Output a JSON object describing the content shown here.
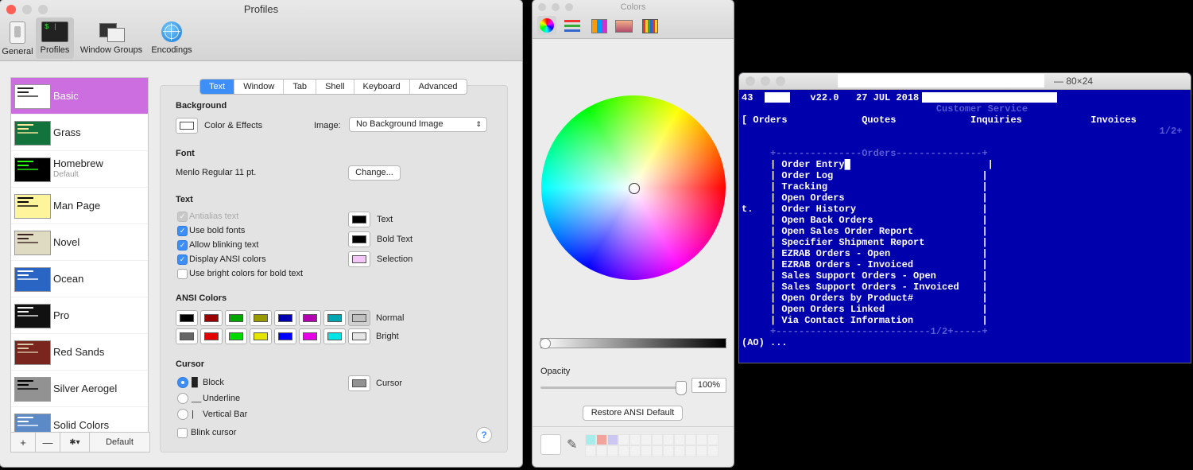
{
  "prefs": {
    "title": "Profiles",
    "toolbar": [
      {
        "label": "General",
        "icon": "switch-icon"
      },
      {
        "label": "Profiles",
        "icon": "terminal-icon",
        "selected": true
      },
      {
        "label": "Window Groups",
        "icon": "window-groups-icon"
      },
      {
        "label": "Encodings",
        "icon": "globe-icon"
      }
    ],
    "profiles": [
      {
        "name": "Basic",
        "sub": "",
        "colors": [
          "#ffffff",
          "#222222"
        ]
      },
      {
        "name": "Grass",
        "sub": "",
        "colors": [
          "#12733c",
          "#ffe99e"
        ]
      },
      {
        "name": "Homebrew",
        "sub": "Default",
        "colors": [
          "#000000",
          "#28fe14"
        ]
      },
      {
        "name": "Man Page",
        "sub": "",
        "colors": [
          "#fef49c",
          "#000000"
        ]
      },
      {
        "name": "Novel",
        "sub": "",
        "colors": [
          "#dfdbc3",
          "#3b2322"
        ]
      },
      {
        "name": "Ocean",
        "sub": "",
        "colors": [
          "#2b65c4",
          "#ffffff"
        ]
      },
      {
        "name": "Pro",
        "sub": "",
        "colors": [
          "#111111",
          "#f2f2f2"
        ]
      },
      {
        "name": "Red Sands",
        "sub": "",
        "colors": [
          "#7a251e",
          "#d7c9a7"
        ]
      },
      {
        "name": "Silver Aerogel",
        "sub": "",
        "colors": [
          "#929292",
          "#000000"
        ]
      },
      {
        "name": "Solid Colors",
        "sub": "",
        "colors": [
          "#5b8ac6",
          "#ffffff"
        ]
      }
    ],
    "footer": {
      "add": "+",
      "remove": "—",
      "gear": "✱▾",
      "default": "Default"
    },
    "tabs": [
      "Text",
      "Window",
      "Tab",
      "Shell",
      "Keyboard",
      "Advanced"
    ],
    "background": {
      "heading": "Background",
      "color_effects": "Color & Effects",
      "image_label": "Image:",
      "image_value": "No Background Image"
    },
    "font": {
      "heading": "Font",
      "value": "Menlo Regular 11 pt.",
      "change": "Change..."
    },
    "text": {
      "heading": "Text",
      "options": [
        {
          "label": "Antialias text",
          "state": "disabled"
        },
        {
          "label": "Use bold fonts",
          "state": "on"
        },
        {
          "label": "Allow blinking text",
          "state": "on"
        },
        {
          "label": "Display ANSI colors",
          "state": "on"
        },
        {
          "label": "Use bright colors for bold text",
          "state": "off"
        }
      ],
      "wells": [
        {
          "label": "Text",
          "color": "#000000"
        },
        {
          "label": "Bold Text",
          "color": "#000000"
        },
        {
          "label": "Selection",
          "color": "#f4c6f8"
        }
      ]
    },
    "ansi": {
      "heading": "ANSI Colors",
      "normal_label": "Normal",
      "bright_label": "Bright",
      "normal": [
        "#000000",
        "#990000",
        "#00a600",
        "#999900",
        "#0000b2",
        "#b200b2",
        "#00a6b2",
        "#bfbfbf"
      ],
      "bright": [
        "#666666",
        "#e50000",
        "#00d900",
        "#e5e500",
        "#0000ff",
        "#e500e5",
        "#00e5e5",
        "#e5e5e5"
      ]
    },
    "cursor": {
      "heading": "Cursor",
      "options": [
        {
          "glyph": "█",
          "label": "Block",
          "on": true
        },
        {
          "glyph": "__",
          "label": "Underline",
          "on": false
        },
        {
          "glyph": "|",
          "label": "Vertical Bar",
          "on": false
        }
      ],
      "blink": "Blink cursor",
      "well_label": "Cursor",
      "well_color": "#929292"
    },
    "help": "?"
  },
  "colors": {
    "title": "Colors",
    "tools": [
      "color-wheel-icon",
      "sliders-icon",
      "palettes-icon",
      "image-palettes-icon",
      "pencils-icon"
    ],
    "opacity_label": "Opacity",
    "opacity_value": "100%",
    "restore": "Restore ANSI Default",
    "swatches": [
      "#a9ecec",
      "#f2a39c",
      "#cbc6f1"
    ]
  },
  "terminal": {
    "title": "— 80×24",
    "lines": [
      {
        "text": "43          v22.0   27 JUL 2018",
        "cls": ""
      },
      {
        "text": "                                  Customer Service",
        "cls": "tdim"
      },
      {
        "text": "[ Orders             Quotes             Inquiries            Invoices          ]",
        "cls": ""
      },
      {
        "text": "                                                                         1/2+",
        "cls": "tdim"
      },
      {
        "text": "",
        "cls": ""
      },
      {
        "text": "     +---------------Orders---------------+",
        "cls": "tdim"
      },
      {
        "text": "     | Order Entry█                        |",
        "cls": ""
      },
      {
        "text": "     | Order Log                          |",
        "cls": ""
      },
      {
        "text": "     | Tracking                           |",
        "cls": ""
      },
      {
        "text": "     | Open Orders                        |",
        "cls": ""
      },
      {
        "text": "t.   | Order History                      |",
        "cls": ""
      },
      {
        "text": "     | Open Back Orders                   |",
        "cls": ""
      },
      {
        "text": "     | Open Sales Order Report            |",
        "cls": ""
      },
      {
        "text": "     | Specifier Shipment Report          |",
        "cls": ""
      },
      {
        "text": "     | EZRAB Orders - Open                |",
        "cls": ""
      },
      {
        "text": "     | EZRAB Orders - Invoiced            |",
        "cls": ""
      },
      {
        "text": "     | Sales Support Orders - Open        |",
        "cls": ""
      },
      {
        "text": "     | Sales Support Orders - Invoiced    |",
        "cls": ""
      },
      {
        "text": "     | Open Orders by Product#            |",
        "cls": ""
      },
      {
        "text": "     | Open Orders Linked                 |",
        "cls": ""
      },
      {
        "text": "     | Via Contact Information            |",
        "cls": ""
      },
      {
        "text": "     +---------------------------1/2+-----+",
        "cls": "tdim"
      },
      {
        "text": "(AO) ...",
        "cls": ""
      }
    ]
  }
}
